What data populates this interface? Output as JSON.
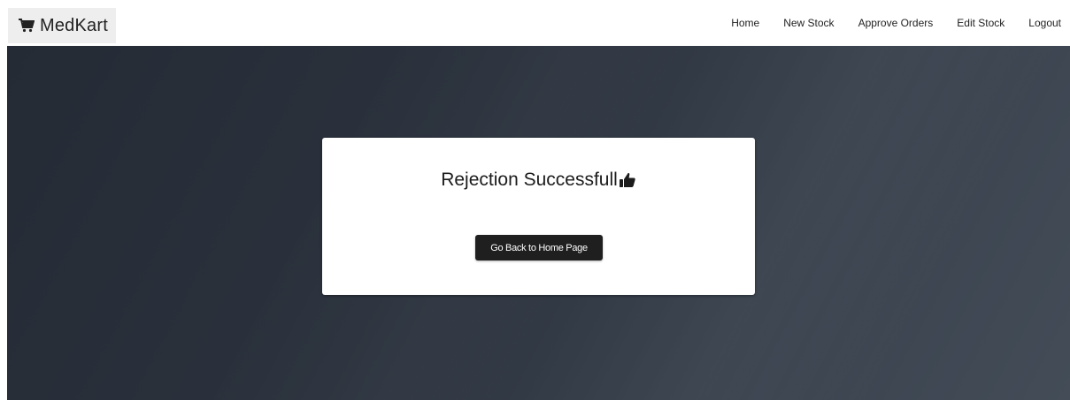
{
  "navbar": {
    "brand": {
      "icon": "shopping-cart-icon",
      "label": "MedKart"
    },
    "links": [
      {
        "label": "Home"
      },
      {
        "label": "New Stock"
      },
      {
        "label": "Approve Orders"
      },
      {
        "label": "Edit Stock"
      },
      {
        "label": "Logout"
      }
    ]
  },
  "message_card": {
    "title": "Rejection Successfull",
    "title_icon": "thumbs-up-icon",
    "button_label": "Go Back to Home Page"
  },
  "colors": {
    "hero_dark": "#252b35",
    "hero_light": "#434c57",
    "button_bg": "#1f1f1f",
    "brand_bg": "#eeeeee"
  }
}
